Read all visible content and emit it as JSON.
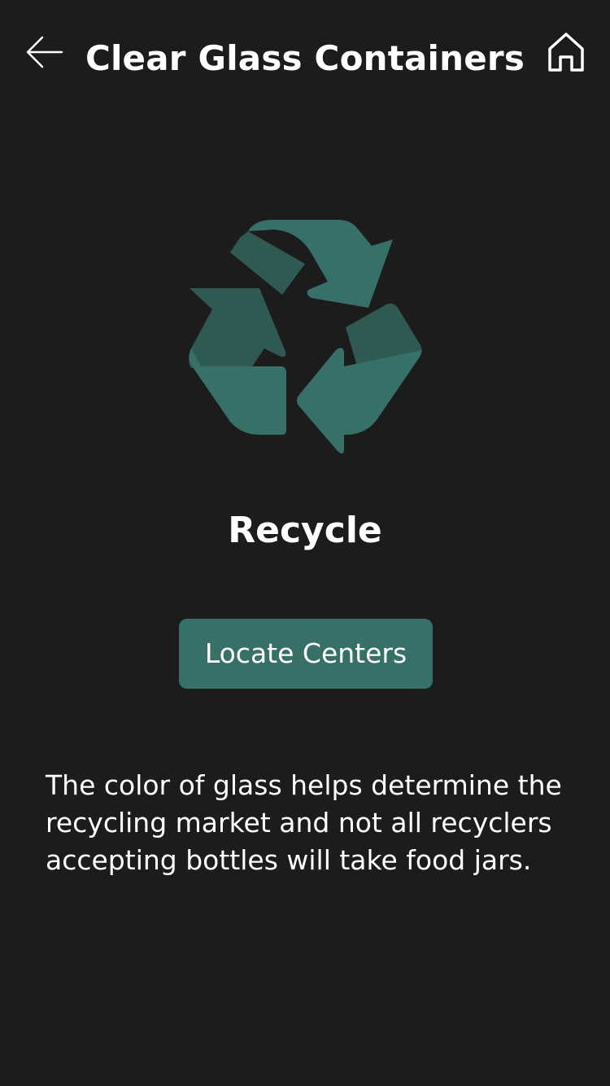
{
  "header": {
    "title": "Clear Glass Containers",
    "back_icon": "arrow-left-icon",
    "home_icon": "home-icon"
  },
  "result": {
    "icon": "recycle-icon",
    "category": "Recycle",
    "action_label": "Locate Centers"
  },
  "description": "The color of glass helps determine the recycling market and not all recyclers accepting bottles will take food jars.",
  "colors": {
    "background": "#1c1c1c",
    "accent": "#367068",
    "accent_dark": "#2f5a54",
    "text": "#ffffff"
  }
}
